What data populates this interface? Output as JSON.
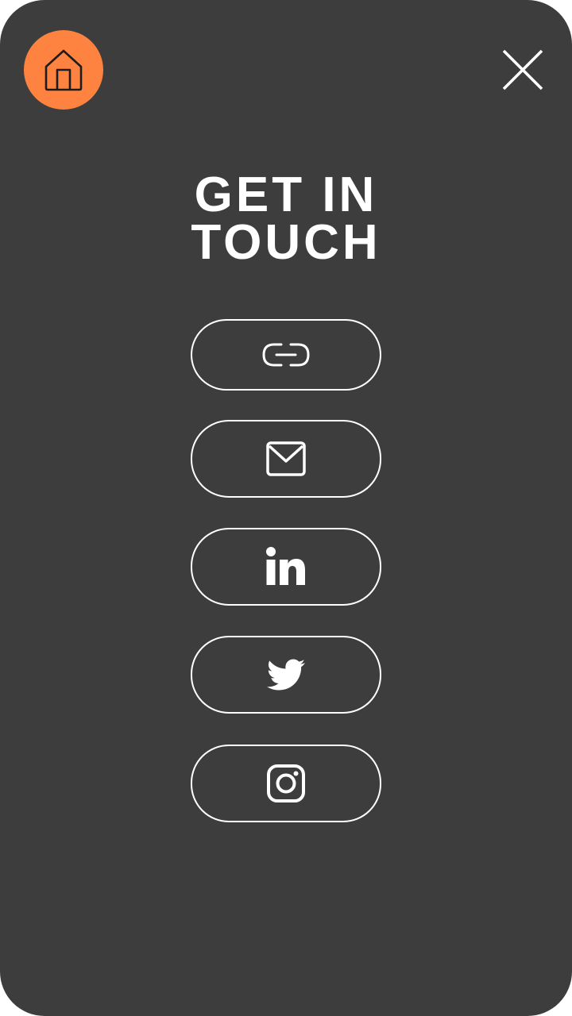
{
  "header": {
    "title_line1": "GET IN",
    "title_line2": "TOUCH"
  },
  "icons": {
    "home": "home-icon",
    "close": "close-icon"
  },
  "contacts": [
    {
      "icon": "link-icon"
    },
    {
      "icon": "mail-icon"
    },
    {
      "icon": "linkedin-icon"
    },
    {
      "icon": "twitter-icon"
    },
    {
      "icon": "instagram-icon"
    }
  ],
  "colors": {
    "background": "#3d3d3d",
    "accent": "#ff8340",
    "foreground": "#ffffff"
  }
}
